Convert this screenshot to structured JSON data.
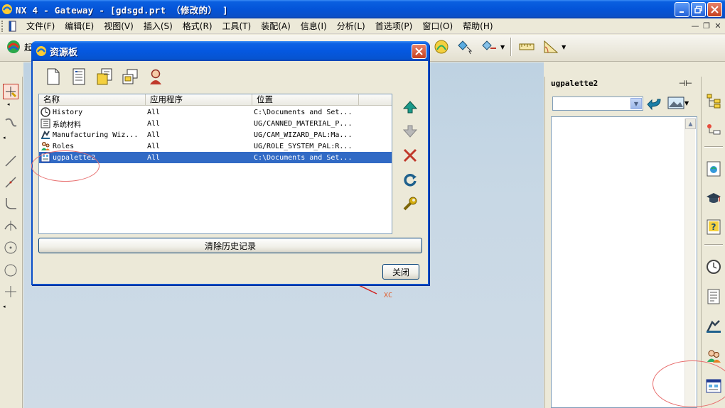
{
  "window": {
    "title": "NX 4 - Gateway - [gdsgd.prt （修改的） ]"
  },
  "menubar": {
    "items": [
      "文件(F)",
      "编辑(E)",
      "视图(V)",
      "插入(S)",
      "格式(R)",
      "工具(T)",
      "装配(A)",
      "信息(I)",
      "分析(L)",
      "首选项(P)",
      "窗口(O)",
      "帮助(H)"
    ]
  },
  "toolbar": {
    "start_label": "起"
  },
  "graphics": {
    "axis_label": "XC"
  },
  "dialog": {
    "title": "资源板",
    "columns": [
      "名称",
      "应用程序",
      "位置"
    ],
    "rows": [
      {
        "name": "History",
        "app": "All",
        "location": "C:\\Documents and Set...",
        "icon": "clock-icon",
        "selected": false
      },
      {
        "name": "系统材料",
        "app": "All",
        "location": "UG/CANNED_MATERIAL_P...",
        "icon": "material-book-icon",
        "selected": false
      },
      {
        "name": "Manufacturing Wiz...",
        "app": "All",
        "location": "UG/CAM_WIZARD_PAL:Ma...",
        "icon": "manufacturing-icon",
        "selected": false
      },
      {
        "name": "Roles",
        "app": "All",
        "location": "UG/ROLE_SYSTEM_PAL:R...",
        "icon": "roles-icon",
        "selected": false
      },
      {
        "name": "ugpalette2",
        "app": "All",
        "location": "C:\\Documents and Set...",
        "icon": "palette-icon",
        "selected": true
      }
    ],
    "clear_history_label": "清除历史记录",
    "close_label": "关闭"
  },
  "resource_panel": {
    "title": "ugpalette2",
    "combo_value": ""
  },
  "colors": {
    "titlebar": "#0454d8",
    "selection": "#316ac5",
    "annotation": "#e87070"
  }
}
